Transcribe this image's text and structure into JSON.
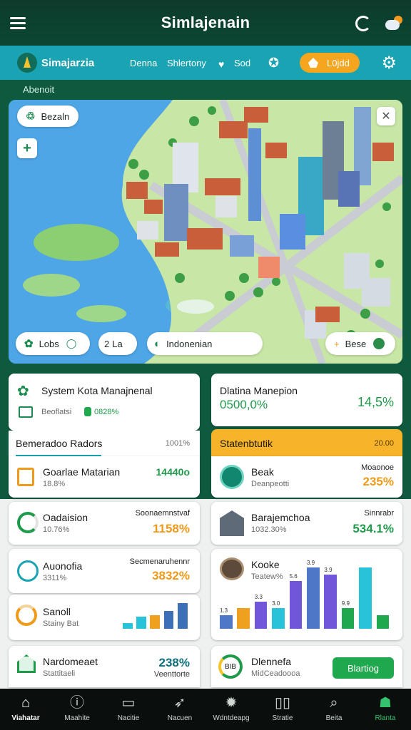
{
  "topbar": {
    "title": "Simlajenain"
  },
  "subbar": {
    "brand": "Simajarzia",
    "nav": [
      "Denna",
      "Shlertony",
      "Sod"
    ],
    "pill": "L0jdd"
  },
  "section_title": "Abenoit",
  "map": {
    "top_left_label": "Bezaln",
    "buttons": [
      "Lobs",
      "La",
      "Indonenian",
      "Bese"
    ]
  },
  "card_system": {
    "title": "System Kota Manajnenal",
    "sub": "Beoflatsi",
    "sub_value": "0828%"
  },
  "card_right_top": {
    "title": "Dlatina Manepion",
    "value": "0500,0%",
    "percent": "14,5%"
  },
  "section_left": {
    "title": "Bemeradoo Radors",
    "right": "1001%"
  },
  "section_right": {
    "title": "Statenbtutik",
    "right": "20.00"
  },
  "left_items": [
    {
      "title": "Goarlae Matarian",
      "sub": "18.8%",
      "right_label": "",
      "value": "14440o"
    },
    {
      "title": "Oadaision",
      "sub": "10.76%",
      "right_label": "Soonaemnstvaf",
      "value": "1158%"
    },
    {
      "title": "Auonofia",
      "sub": "3311%",
      "right_label": "Secmenaruhennr",
      "value": "3832%"
    },
    {
      "title": "Sanoll",
      "sub": "Stainy Bat",
      "right_label": "",
      "value": ""
    },
    {
      "title": "Nardomeaet",
      "sub": "Stattitaeli",
      "right_label": "",
      "value": "238%",
      "value2": "Veenttorte"
    }
  ],
  "right_items": [
    {
      "title": "Beak",
      "sub": "Deanpeotti",
      "right_label": "Moaonoe",
      "value": "235%"
    },
    {
      "title": "Barajemchoa",
      "sub": "1032.30%",
      "right_label": "Sinnrabr",
      "value": "534.1%"
    },
    {
      "title": "Kooke",
      "sub": "Teatew%",
      "right_label": "",
      "value": ""
    },
    {
      "title": "Dlennefa",
      "sub": "MidCeadoooa",
      "right_label": "",
      "value": ""
    }
  ],
  "ring_label": "BIB",
  "action_button": "Blartiog",
  "chart_data": [
    {
      "type": "bar",
      "categories": [
        "1",
        "2",
        "3",
        "4",
        "5"
      ],
      "values": [
        3,
        6,
        7,
        9,
        13
      ],
      "colors": [
        "#28c3d8",
        "#28c3d8",
        "#efa01f",
        "#3d6fb6",
        "#3d6fb6"
      ]
    },
    {
      "type": "bar",
      "categories": [
        "1",
        "2",
        "3",
        "4",
        "5",
        "6",
        "7",
        "8",
        "9",
        "10"
      ],
      "values": [
        2,
        3,
        4,
        3,
        7,
        9,
        8,
        3,
        9,
        2
      ],
      "labels": [
        "1.3",
        "",
        "3.3",
        "3.0",
        "5.6",
        "3.9",
        "3.9",
        "9.9",
        "",
        ""
      ],
      "colors": [
        "#4e77c7",
        "#efa01f",
        "#7156d9",
        "#28c3d8",
        "#7156d9",
        "#4e77c7",
        "#7156d9",
        "#1fa84e",
        "#28c3d8",
        "#1fa84e"
      ]
    }
  ],
  "bottom_tabs": [
    "Viahatar",
    "Maahite",
    "Nacitie",
    "Nacuen",
    "Wdntdeapg",
    "Stratie",
    "Beita",
    "Rlanta"
  ]
}
